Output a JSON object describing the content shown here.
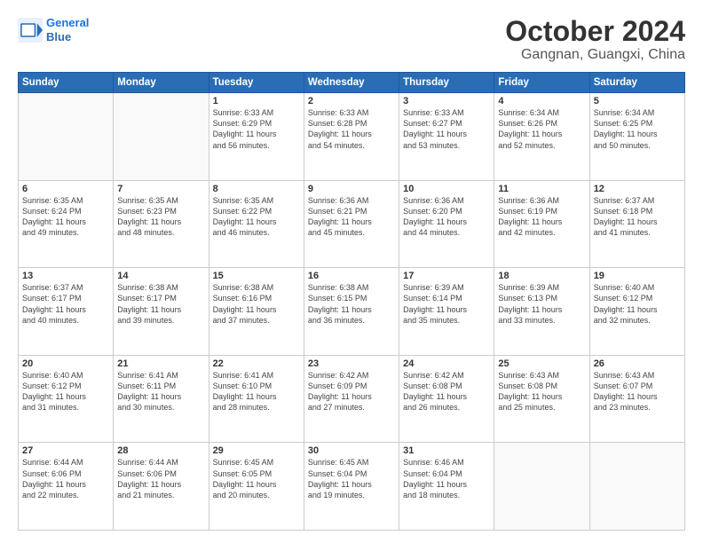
{
  "logo": {
    "line1": "General",
    "line2": "Blue"
  },
  "title": "October 2024",
  "subtitle": "Gangnan, Guangxi, China",
  "header_days": [
    "Sunday",
    "Monday",
    "Tuesday",
    "Wednesday",
    "Thursday",
    "Friday",
    "Saturday"
  ],
  "weeks": [
    [
      {
        "day": "",
        "info": ""
      },
      {
        "day": "",
        "info": ""
      },
      {
        "day": "1",
        "info": "Sunrise: 6:33 AM\nSunset: 6:29 PM\nDaylight: 11 hours\nand 56 minutes."
      },
      {
        "day": "2",
        "info": "Sunrise: 6:33 AM\nSunset: 6:28 PM\nDaylight: 11 hours\nand 54 minutes."
      },
      {
        "day": "3",
        "info": "Sunrise: 6:33 AM\nSunset: 6:27 PM\nDaylight: 11 hours\nand 53 minutes."
      },
      {
        "day": "4",
        "info": "Sunrise: 6:34 AM\nSunset: 6:26 PM\nDaylight: 11 hours\nand 52 minutes."
      },
      {
        "day": "5",
        "info": "Sunrise: 6:34 AM\nSunset: 6:25 PM\nDaylight: 11 hours\nand 50 minutes."
      }
    ],
    [
      {
        "day": "6",
        "info": "Sunrise: 6:35 AM\nSunset: 6:24 PM\nDaylight: 11 hours\nand 49 minutes."
      },
      {
        "day": "7",
        "info": "Sunrise: 6:35 AM\nSunset: 6:23 PM\nDaylight: 11 hours\nand 48 minutes."
      },
      {
        "day": "8",
        "info": "Sunrise: 6:35 AM\nSunset: 6:22 PM\nDaylight: 11 hours\nand 46 minutes."
      },
      {
        "day": "9",
        "info": "Sunrise: 6:36 AM\nSunset: 6:21 PM\nDaylight: 11 hours\nand 45 minutes."
      },
      {
        "day": "10",
        "info": "Sunrise: 6:36 AM\nSunset: 6:20 PM\nDaylight: 11 hours\nand 44 minutes."
      },
      {
        "day": "11",
        "info": "Sunrise: 6:36 AM\nSunset: 6:19 PM\nDaylight: 11 hours\nand 42 minutes."
      },
      {
        "day": "12",
        "info": "Sunrise: 6:37 AM\nSunset: 6:18 PM\nDaylight: 11 hours\nand 41 minutes."
      }
    ],
    [
      {
        "day": "13",
        "info": "Sunrise: 6:37 AM\nSunset: 6:17 PM\nDaylight: 11 hours\nand 40 minutes."
      },
      {
        "day": "14",
        "info": "Sunrise: 6:38 AM\nSunset: 6:17 PM\nDaylight: 11 hours\nand 39 minutes."
      },
      {
        "day": "15",
        "info": "Sunrise: 6:38 AM\nSunset: 6:16 PM\nDaylight: 11 hours\nand 37 minutes."
      },
      {
        "day": "16",
        "info": "Sunrise: 6:38 AM\nSunset: 6:15 PM\nDaylight: 11 hours\nand 36 minutes."
      },
      {
        "day": "17",
        "info": "Sunrise: 6:39 AM\nSunset: 6:14 PM\nDaylight: 11 hours\nand 35 minutes."
      },
      {
        "day": "18",
        "info": "Sunrise: 6:39 AM\nSunset: 6:13 PM\nDaylight: 11 hours\nand 33 minutes."
      },
      {
        "day": "19",
        "info": "Sunrise: 6:40 AM\nSunset: 6:12 PM\nDaylight: 11 hours\nand 32 minutes."
      }
    ],
    [
      {
        "day": "20",
        "info": "Sunrise: 6:40 AM\nSunset: 6:12 PM\nDaylight: 11 hours\nand 31 minutes."
      },
      {
        "day": "21",
        "info": "Sunrise: 6:41 AM\nSunset: 6:11 PM\nDaylight: 11 hours\nand 30 minutes."
      },
      {
        "day": "22",
        "info": "Sunrise: 6:41 AM\nSunset: 6:10 PM\nDaylight: 11 hours\nand 28 minutes."
      },
      {
        "day": "23",
        "info": "Sunrise: 6:42 AM\nSunset: 6:09 PM\nDaylight: 11 hours\nand 27 minutes."
      },
      {
        "day": "24",
        "info": "Sunrise: 6:42 AM\nSunset: 6:08 PM\nDaylight: 11 hours\nand 26 minutes."
      },
      {
        "day": "25",
        "info": "Sunrise: 6:43 AM\nSunset: 6:08 PM\nDaylight: 11 hours\nand 25 minutes."
      },
      {
        "day": "26",
        "info": "Sunrise: 6:43 AM\nSunset: 6:07 PM\nDaylight: 11 hours\nand 23 minutes."
      }
    ],
    [
      {
        "day": "27",
        "info": "Sunrise: 6:44 AM\nSunset: 6:06 PM\nDaylight: 11 hours\nand 22 minutes."
      },
      {
        "day": "28",
        "info": "Sunrise: 6:44 AM\nSunset: 6:06 PM\nDaylight: 11 hours\nand 21 minutes."
      },
      {
        "day": "29",
        "info": "Sunrise: 6:45 AM\nSunset: 6:05 PM\nDaylight: 11 hours\nand 20 minutes."
      },
      {
        "day": "30",
        "info": "Sunrise: 6:45 AM\nSunset: 6:04 PM\nDaylight: 11 hours\nand 19 minutes."
      },
      {
        "day": "31",
        "info": "Sunrise: 6:46 AM\nSunset: 6:04 PM\nDaylight: 11 hours\nand 18 minutes."
      },
      {
        "day": "",
        "info": ""
      },
      {
        "day": "",
        "info": ""
      }
    ]
  ]
}
